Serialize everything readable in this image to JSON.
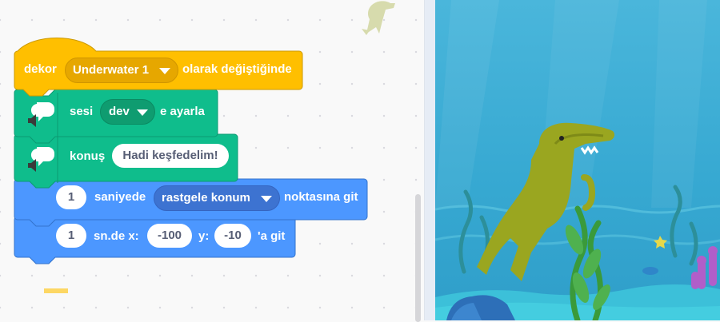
{
  "workspace": {
    "hat_block": {
      "prefix": "dekor",
      "backdrop": "Underwater 1",
      "suffix": "olarak değiştiğinde"
    },
    "voice_block": {
      "label": "sesi",
      "voice": "dev",
      "suffix": "e ayarla"
    },
    "speak_block": {
      "label": "konuş",
      "text": "Hadi keşfedelim!"
    },
    "glide_random_block": {
      "seconds": "1",
      "label": "saniyede",
      "target": "rastgele konum",
      "suffix": "noktasına git"
    },
    "glide_xy_block": {
      "seconds": "1",
      "label": "sn.de x:",
      "x": "-100",
      "y_label": "y:",
      "y": "-10",
      "suffix": "'a git"
    }
  },
  "colors": {
    "events": "#ffbf00",
    "extension": "#0fbd8c",
    "motion": "#4c97ff",
    "underwater_bg": "#3fb4d8"
  },
  "icons": [
    "speech-balloon-icon",
    "speaker-icon",
    "dropdown-arrow-icon",
    "dinosaur-sprite"
  ]
}
